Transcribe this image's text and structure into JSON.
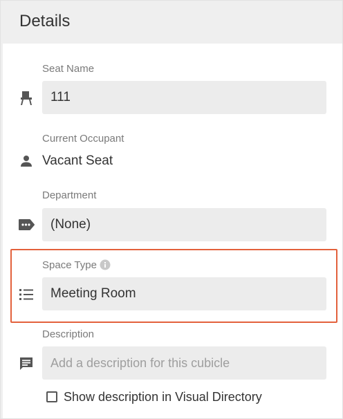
{
  "header": {
    "title": "Details"
  },
  "fields": {
    "seat_name": {
      "label": "Seat Name",
      "value": "111",
      "icon": "chair-icon"
    },
    "current_occupant": {
      "label": "Current Occupant",
      "value": "Vacant Seat",
      "icon": "person-icon"
    },
    "department": {
      "label": "Department",
      "value": "(None)",
      "icon": "tag-icon"
    },
    "space_type": {
      "label": "Space Type",
      "value": "Meeting Room",
      "icon": "list-icon",
      "info_icon": "info-icon",
      "highlight_color": "#e3603b"
    },
    "description": {
      "label": "Description",
      "placeholder": "Add a description for this cubicle",
      "icon": "comment-icon"
    }
  },
  "show_description": {
    "label": "Show description in Visual Directory",
    "checked": false
  }
}
